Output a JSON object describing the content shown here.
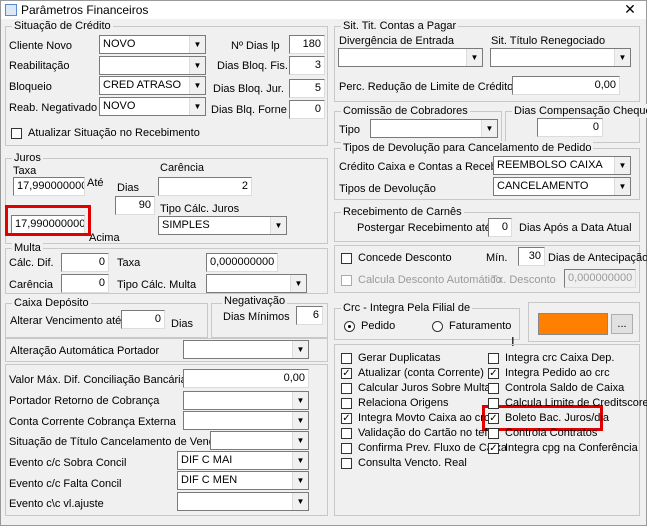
{
  "window": {
    "title": "Parâmetros Financeiros",
    "close_glyph": "✕"
  },
  "situacao_credito": {
    "title": "Situação de Crédito",
    "cliente_novo": {
      "label": "Cliente Novo",
      "value": "NOVO"
    },
    "reabilitacao": {
      "label": "Reabilitação",
      "value": ""
    },
    "bloqueio": {
      "label": "Bloqueio",
      "value": "CRED ATRASO"
    },
    "reab_negativado": {
      "label": "Reab. Negativado",
      "value": "NOVO"
    },
    "dias_lp": {
      "label": "Nº Dias lp",
      "value": "180"
    },
    "dias_bloq_fis": {
      "label": "Dias Bloq. Fis.",
      "value": "3"
    },
    "dias_bloq_jur": {
      "label": "Dias Bloq. Jur.",
      "value": "5"
    },
    "dias_blq_forne": {
      "label": "Dias Blq. Forne",
      "value": "0"
    },
    "atualizar": {
      "label": "Atualizar Situação no Recebimento",
      "checked": false
    }
  },
  "juros": {
    "title": "Juros",
    "taxa_label": "Taxa",
    "taxa_value": "17,990000000",
    "ate_label": "Até",
    "dias_label": "Dias",
    "dias_value": "90",
    "acima_value": "17,990000000",
    "acima_label": "Acima",
    "carencia_label": "Carência",
    "carencia_value": "2",
    "tipo_calc_label": "Tipo Cálc. Juros",
    "tipo_calc_value": "SIMPLES"
  },
  "multa": {
    "title": "Multa",
    "calc_dif_label": "Cálc. Dif.",
    "calc_dif_value": "0",
    "taxa_label": "Taxa",
    "taxa_value": "0,000000000",
    "carencia_label": "Carência",
    "carencia_value": "0",
    "tipo_calc_label": "Tipo Cálc. Multa",
    "tipo_calc_value": ""
  },
  "caixa_deposito": {
    "title": "Caixa Depósito",
    "alterar_label": "Alterar Vencimento até",
    "alterar_value": "0",
    "dias_label": "Dias"
  },
  "negativacao": {
    "title": "Negativação",
    "dias_minimos_label": "Dias Mínimos",
    "dias_minimos_value": "6"
  },
  "alteracao_portador": {
    "label": "Alteração Automática Portador",
    "value": ""
  },
  "lower_left": {
    "valor_max": {
      "label": "Valor Máx. Dif. Conciliação Bancária",
      "value": "0,00"
    },
    "portador_retorno": {
      "label": "Portador Retorno de Cobrança",
      "value": ""
    },
    "conta_corrente": {
      "label": "Conta Corrente Cobrança Externa",
      "value": ""
    },
    "situacao_titulo": {
      "label": "Situação de Título Cancelamento de Venda",
      "value": ""
    },
    "evento_sobra": {
      "label": "Evento c/c Sobra Concil",
      "value": "DIF C MAI"
    },
    "evento_falta": {
      "label": "Evento c/c Falta Concil",
      "value": "DIF C MEN"
    },
    "evento_ajuste": {
      "label": "Evento c\\c vl.ajuste",
      "value": ""
    }
  },
  "sit_tit_contas": {
    "title": "Sit. Tit. Contas a Pagar",
    "divergencia_label": "Divergência de Entrada",
    "divergencia_value": "",
    "renegociado_label": "Sit. Título Renegociado",
    "renegociado_value": "",
    "perc_label": "Perc. Redução de Limite de Crédito",
    "perc_value": "0,00"
  },
  "comissao": {
    "title": "Comissão de Cobradores",
    "tipo_label": "Tipo",
    "tipo_value": ""
  },
  "dias_compensacao": {
    "title": "Dias Compensação Cheque",
    "value": "0"
  },
  "tipos_devolucao": {
    "title": "Tipos de Devolução para Cancelamento de Pedido",
    "credito_label": "Crédito Caixa e Contas a Receber",
    "credito_value": "REEMBOLSO CAIXA",
    "tipos_label": "Tipos de Devolução",
    "tipos_value": "CANCELAMENTO"
  },
  "recebimento_carnes": {
    "title": "Recebimento de Carnês",
    "postergar_label": "Postergar Recebimento até",
    "postergar_value": "0",
    "dias_apos_label": "Dias Após a Data Atual"
  },
  "desconto": {
    "concede_label": "Concede Desconto",
    "min_label": "Mín.",
    "min_value": "30",
    "dias_antecip_label": "Dias de Antecipação",
    "calcula_label": "Calcula Desconto Automático",
    "tx_label": "Tx. Desconto",
    "tx_value": "0,000000000"
  },
  "crc": {
    "title": "Crc - Integra Pela Filial de",
    "pedido_label": "Pedido",
    "faturamento_label": "Faturamento",
    "selected": "Pedido",
    "color": "#ff8000",
    "button_label": "..."
  },
  "checks_left": [
    {
      "label": "Gerar Duplicatas",
      "checked": false
    },
    {
      "label": "Atualizar (conta Corrente)",
      "checked": true
    },
    {
      "label": "Calcular Juros Sobre Multa",
      "checked": false
    },
    {
      "label": "Relaciona Origens",
      "checked": false
    },
    {
      "label": "Integra Movto Caixa ao crc",
      "checked": true
    },
    {
      "label": "Validação do Cartão no tef",
      "checked": false
    },
    {
      "label": "Confirma Prev. Fluxo de Caixa",
      "checked": false
    },
    {
      "label": "Consulta Vencto. Real",
      "checked": false
    }
  ],
  "checks_right": [
    {
      "label": "Integra crc Caixa Dep.",
      "checked": false
    },
    {
      "label": "Integra Pedido ao crc",
      "checked": true
    },
    {
      "label": "Controla Saldo de Caixa",
      "checked": false
    },
    {
      "label": "Calcula Limite de Creditscore",
      "checked": false
    },
    {
      "label": "Boleto Bac. Juros/dia",
      "checked": true
    },
    {
      "label": "Controla Contratos",
      "checked": false
    },
    {
      "label": "Integra cpg na Conferência",
      "checked": true
    }
  ],
  "highlight_color": "#e00000",
  "check_glyph": "✓"
}
